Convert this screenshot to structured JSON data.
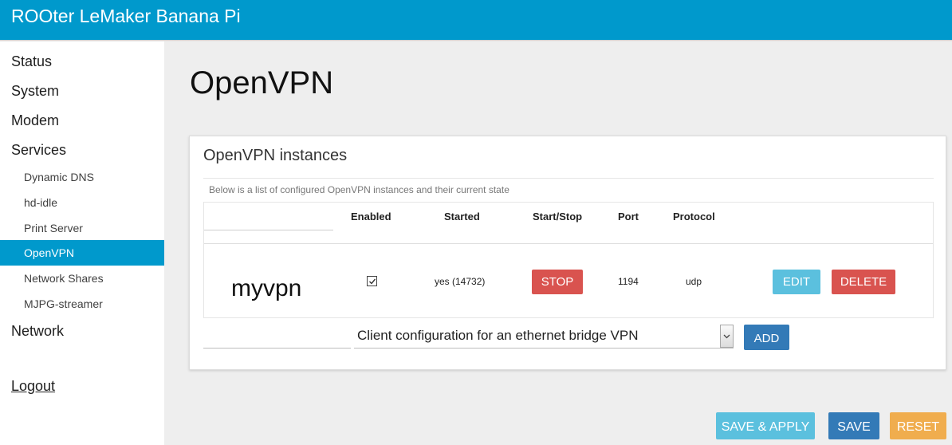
{
  "header": {
    "title": "ROOter LeMaker Banana Pi",
    "accent_color": "#0099cc"
  },
  "sidebar": {
    "items": [
      {
        "label": "Status"
      },
      {
        "label": "System"
      },
      {
        "label": "Modem"
      },
      {
        "label": "Services"
      },
      {
        "label": "Dynamic DNS"
      },
      {
        "label": "hd-idle"
      },
      {
        "label": "Print Server"
      },
      {
        "label": "OpenVPN",
        "active": true
      },
      {
        "label": "Network Shares"
      },
      {
        "label": "MJPG-streamer"
      },
      {
        "label": "Network"
      }
    ],
    "logout": "Logout"
  },
  "page": {
    "title": "OpenVPN"
  },
  "panel": {
    "title": "OpenVPN instances",
    "description": "Below is a list of configured OpenVPN instances and their current state",
    "columns": {
      "enabled": "Enabled",
      "started": "Started",
      "startstop": "Start/Stop",
      "port": "Port",
      "protocol": "Protocol"
    },
    "instance": {
      "name": "myvpn",
      "enabled": true,
      "started": "yes (14732)",
      "stop_label": "STOP",
      "port": "1194",
      "protocol": "udp",
      "edit_label": "EDIT",
      "delete_label": "DELETE"
    },
    "add": {
      "selected_option": "Client configuration for an ethernet bridge VPN",
      "add_label": "ADD"
    }
  },
  "footer": {
    "save_apply": "SAVE & APPLY",
    "save": "SAVE",
    "reset": "RESET"
  },
  "colors": {
    "danger": "#d9534f",
    "info": "#5bc0de",
    "primary": "#337ab7",
    "warning": "#f0ad4e"
  }
}
